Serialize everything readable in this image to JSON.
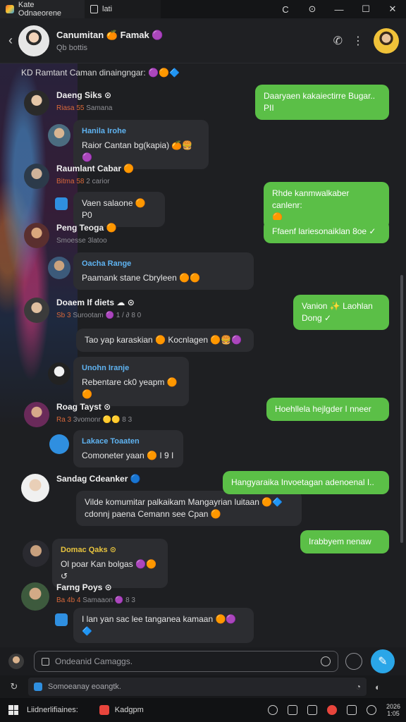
{
  "titlebar": {
    "tab1": "Kate Odnaeorene",
    "tab2": "lati",
    "ctrl_back": "C",
    "ctrl_circle": "⊙",
    "ctrl_min": "—",
    "ctrl_max": "☐",
    "ctrl_close": "✕"
  },
  "header": {
    "title": "Canumitan 🍊 Famak 🟣",
    "subtitle": "Qb bottis",
    "back": "‹",
    "call": "✆",
    "more": "⋮"
  },
  "chat": {
    "notice": "KD Ramtant Caman dinaingngar: 🟣🟠🔷",
    "messages": [
      {
        "name": "Daeng Siks ⊙",
        "meta_hi": "Riasa 55",
        "meta_rest": " Samana"
      },
      {
        "reply_name": "Hanila Irohe",
        "text": "Raior Cantan bg(kapia) 🍊🍔🟣"
      },
      {
        "name": "Raumlant Cabar 🟠",
        "meta_hi": "Bitma 58",
        "meta_rest": " 2 carior"
      },
      {
        "text": "Vaen salaone 🟠 P0"
      },
      {
        "name": "Peng Teoga 🟠",
        "meta_hi": "",
        "meta_rest": "Smoesse 3latoo"
      },
      {
        "reply_name": "Oacha Range",
        "text": "Paamank stane Cbryleen 🟠🟠"
      },
      {
        "name": "Doaem If diets ☁ ⊙",
        "meta_hi": "Sb 3",
        "meta_rest": " Surootam 🟣 1 / ∂ 8 0"
      },
      {
        "text": "Tao yap karaskian 🟠 Kocnlagen 🟠🍔🟣"
      },
      {
        "reply_name": "Unohn Iranje",
        "text": "Rebentare ck0 yeapm 🟠🟠"
      },
      {
        "name": "Roag Tayst ⊙",
        "meta_hi": "Ra 3",
        "meta_rest": " 3vomonr 🟡🟡 8 3"
      },
      {
        "reply_name": "Lakace Toaaten",
        "text": "Comoneter yaan 🟠 I 9 I"
      },
      {
        "name": "Sandag Cdeanker 🔵"
      },
      {
        "text": "Vilde komumitar palkaikam Mangayrian luitaan 🟠🔷",
        "text2": "cdonnj paena Cemann see Cpan 🟠"
      },
      {
        "reply_name": "Domac Qaks ⊙",
        "text": "Ol poar Kan bolgas 🟣🟠 ↺"
      },
      {
        "name": "Farng Poys ⊙",
        "meta_hi": "Ba 4b 4",
        "meta_rest": " Samaaon 🟣 8 3"
      },
      {
        "text": "I lan yan sac lee tanganea kamaan 🟠🟣🔷"
      }
    ],
    "outgoing": [
      {
        "line1": "Daaryaen kakaiectirre Bugar..",
        "line2": "PII"
      },
      {
        "line1": "Rhde kanmwalkaber canlenr:",
        "line2": "🟠"
      },
      {
        "line1": "Ffaenf lariesonaiklan 8oe ✓"
      },
      {
        "line1": "Vanion ✨ Laohlan",
        "line2": "Dong ✓"
      },
      {
        "line1": "Hoehllela hejlgder I nneer"
      },
      {
        "line1": "Hangyaraika Invoetagan adenoenal I.."
      },
      {
        "line1": "Irabbyem nenaw"
      }
    ]
  },
  "composer": {
    "placeholder": "Ondeanid Camaggs.",
    "send": "✎"
  },
  "hint": {
    "left": "↻",
    "text": "Somoeanay eoangtk.",
    "end": "◔",
    "right": "◐"
  },
  "taskbar": {
    "label": "Liidnerlifiaines:",
    "app": "Kadgpm",
    "clock_line1": "2026",
    "clock_line2": "1:05"
  }
}
